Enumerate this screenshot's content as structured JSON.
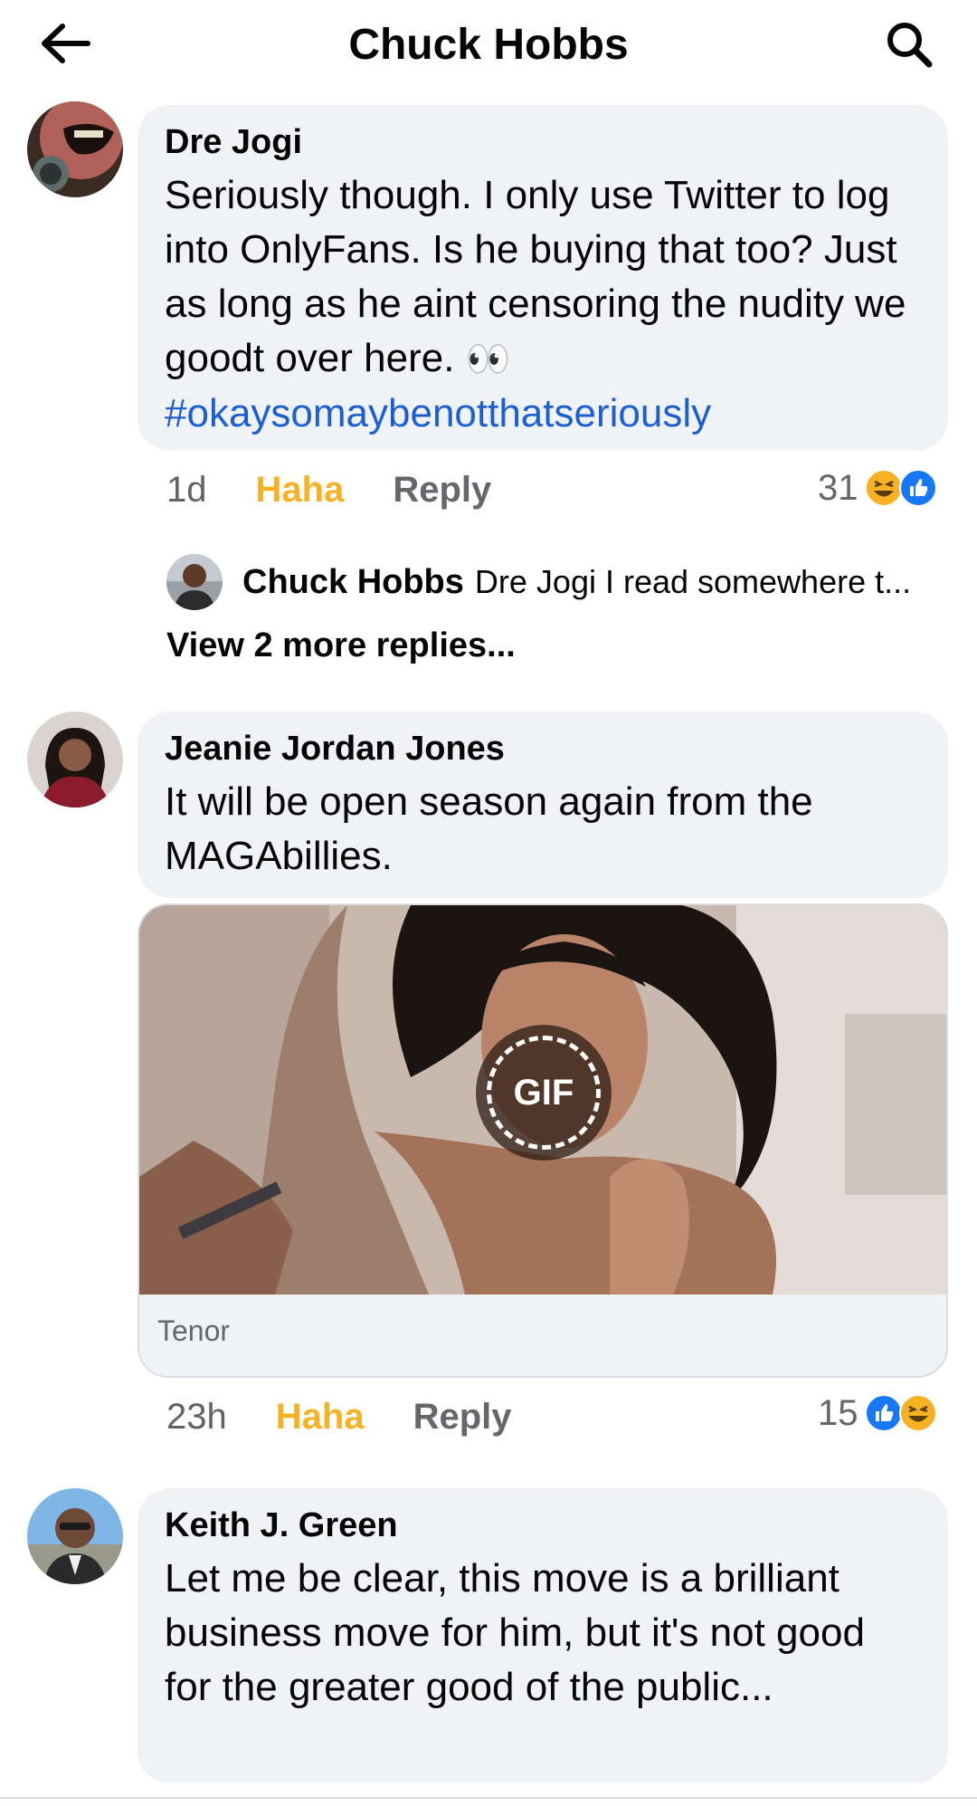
{
  "header": {
    "title": "Chuck Hobbs",
    "back_icon": "arrow-left-icon",
    "search_icon": "search-icon"
  },
  "comments": [
    {
      "author": "Dre Jogi",
      "text": "Seriously though. I only use Twitter to log into OnlyFans. Is he buying that too? Just as long as he aint censoring the nudity we goodt over here.",
      "emoji": "👀",
      "hashtag": "#okaysomaybenotthatseriously",
      "time": "1d",
      "reaction_label": "Haha",
      "reply_label": "Reply",
      "reaction_count": "31",
      "reaction_icons": [
        "haha-icon",
        "like-icon"
      ]
    },
    {
      "author": "Jeanie Jordan Jones",
      "text": "It will be open season again from the MAGAbillies.",
      "time": "23h",
      "reaction_label": "Haha",
      "reply_label": "Reply",
      "reaction_count": "15",
      "reaction_icons": [
        "like-icon",
        "haha-icon"
      ],
      "gif": {
        "badge": "GIF",
        "source": "Tenor"
      }
    },
    {
      "author": "Keith J. Green",
      "text": "Let me be clear, this move is a brilliant business move for him, but it's not good for the greater good of the public..."
    }
  ],
  "reply_preview": {
    "author": "Chuck Hobbs",
    "snippet": "Dre Jogi I read somewhere t..."
  },
  "view_more_replies": "View 2 more replies...",
  "colors": {
    "bubble": "#f0f2f5",
    "haha": "#f7b125",
    "hashtag": "#1b5fd1",
    "like": "#1877f2"
  }
}
